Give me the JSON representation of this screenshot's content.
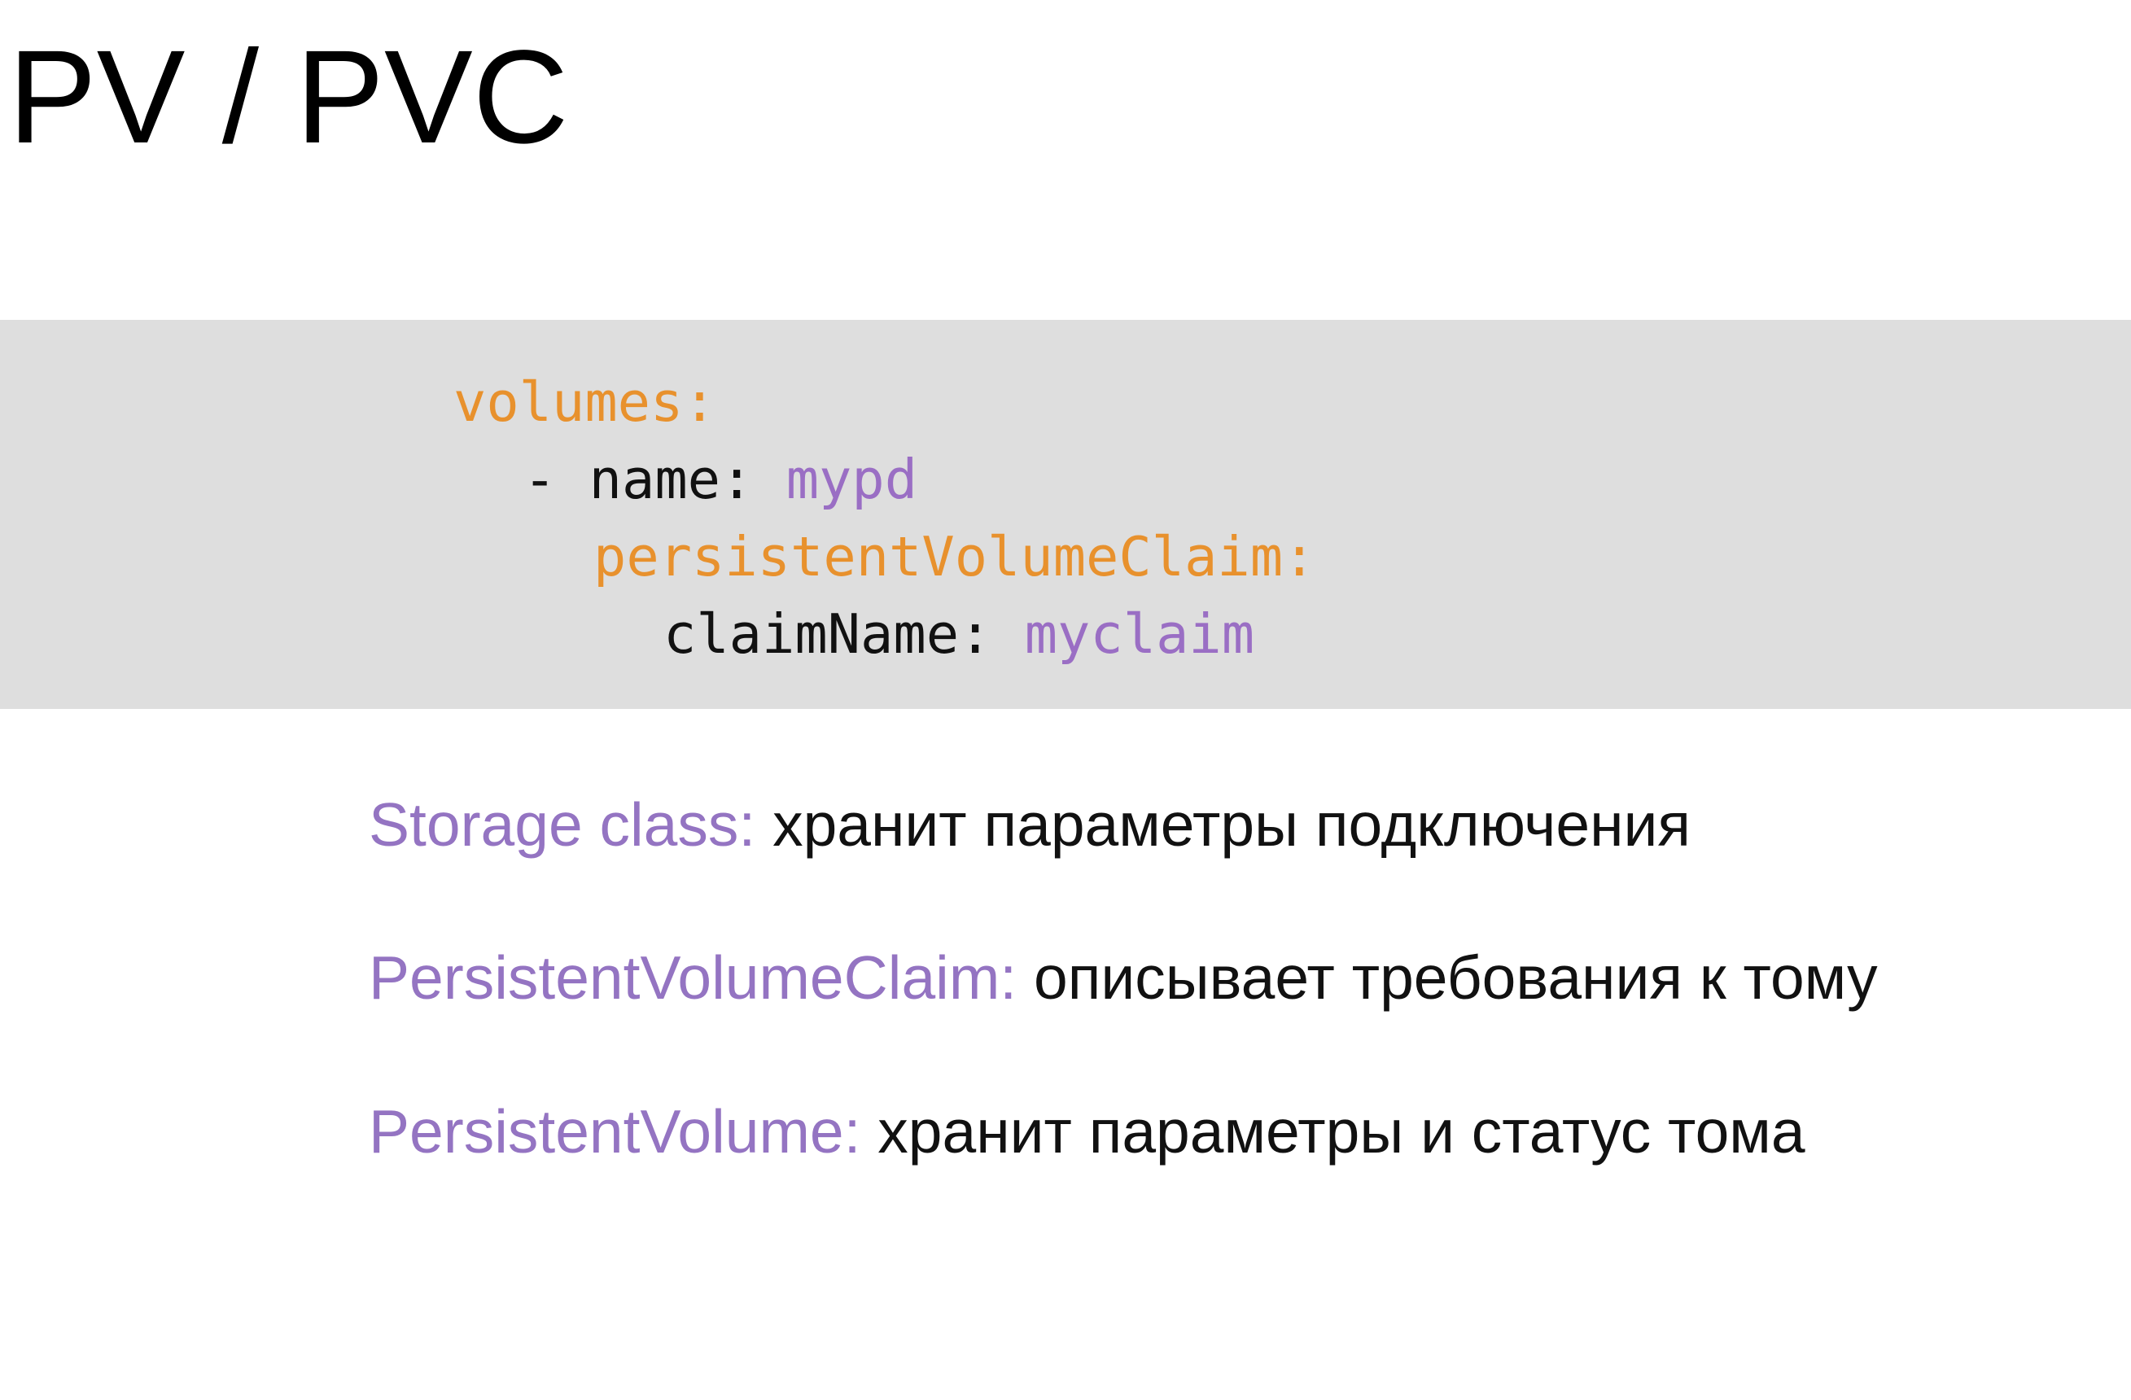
{
  "slide": {
    "title": "PV / PVC"
  },
  "code": {
    "lines": [
      {
        "indent": "",
        "tokens": [
          {
            "text": "volumes:",
            "role": "key"
          }
        ]
      },
      {
        "indent": "",
        "tokens": [
          {
            "text": "- name: ",
            "role": "plain"
          },
          {
            "text": "mypd",
            "role": "value"
          }
        ]
      },
      {
        "indent": "",
        "tokens": [
          {
            "text": "persistentVolumeClaim:",
            "role": "key"
          }
        ]
      },
      {
        "indent": "",
        "tokens": [
          {
            "text": "claimName: ",
            "role": "plain"
          },
          {
            "text": "myclaim",
            "role": "value"
          }
        ]
      }
    ]
  },
  "definitions": [
    {
      "term": "Storage class:",
      "text": " хранит параметры подключения"
    },
    {
      "term": "PersistentVolumeClaim:",
      "text": " описывает требования к тому"
    },
    {
      "term": "PersistentVolume:",
      "text": " хранит параметры и статус тома"
    }
  ],
  "colors": {
    "code_background": "#dedede",
    "yaml_key": "#e8912d",
    "yaml_value": "#9a6ec4",
    "definition_term": "#9474c2",
    "text": "#111111"
  }
}
